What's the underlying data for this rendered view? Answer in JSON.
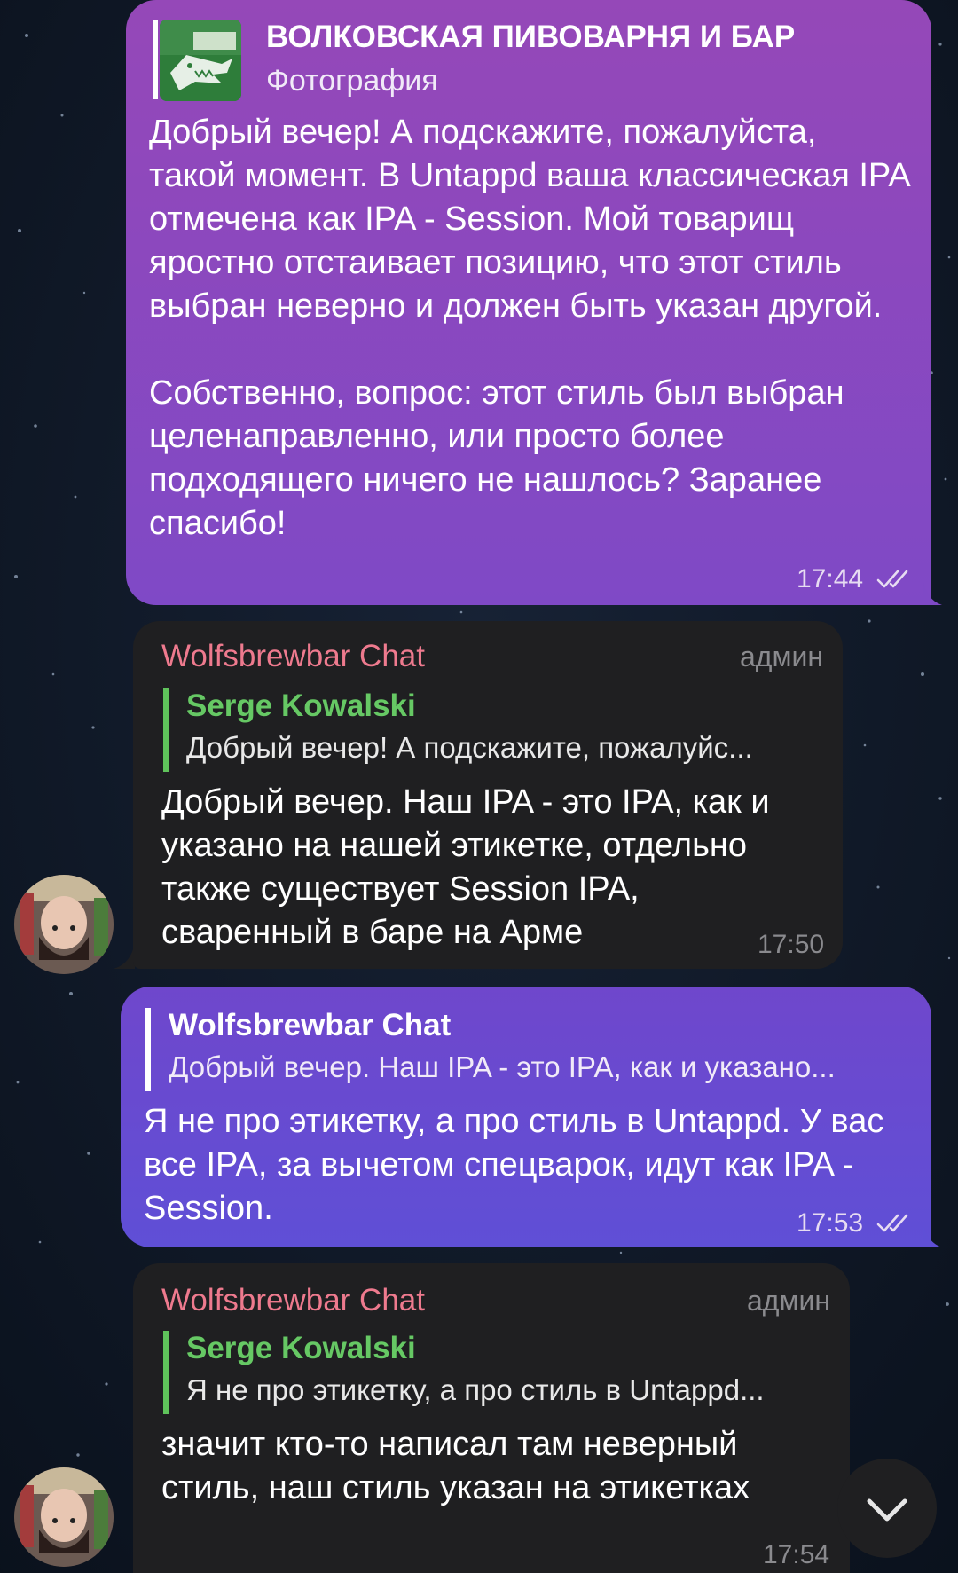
{
  "messages": [
    {
      "reply_title": "ВОЛКОВСКАЯ ПИВОВАРНЯ И БАР",
      "reply_subtitle": "Фотография",
      "text": "Добрый вечер! А подскажите, пожалуйста, такой момент. В Untappd ваша классическая IPA отмечена как IPA - Session. Мой товарищ яростно отстаивает позицию, что этот стиль выбран неверно и должен быть указан другой.\n\nСобственно, вопрос: этот стиль был выбран целенаправленно, или просто более подходящего ничего не нашлось? Заранее спасибо!",
      "time": "17:44"
    },
    {
      "sender": "Wolfsbrewbar Chat",
      "badge": "админ",
      "reply_name": "Serge Kowalski",
      "reply_text": "Добрый вечер! А подскажите, пожалуйс...",
      "text": "Добрый вечер. Наш IPA - это IPA, как и указано на нашей этикетке, отдельно также существует Session IPA, сваренный в баре на Арме",
      "time": "17:50"
    },
    {
      "reply_name": "Wolfsbrewbar Chat",
      "reply_text": "Добрый вечер. Наш IPA - это IPA, как и указано...",
      "text": "Я не про этикетку, а про стиль в Untappd. У вас все IPA, за вычетом спецварок, идут как IPA - Session.",
      "time": "17:53"
    },
    {
      "sender": "Wolfsbrewbar Chat",
      "badge": "админ",
      "reply_name": "Serge Kowalski",
      "reply_text": "Я не про этикетку, а про стиль в Untappd...",
      "text": "значит кто-то написал там неверный стиль, наш стиль указан на этикетках",
      "time": "17:54"
    }
  ],
  "icons": {
    "read_receipt": "double-check-icon",
    "scroll_down": "chevron-down-icon",
    "photo_thumbnail": "wolf-logo-thumbnail",
    "avatar": "user-avatar"
  },
  "colors": {
    "outgoing_top": "#9548b8",
    "outgoing_bottom": "#5f4fd6",
    "incoming": "#1f1f21",
    "sender_name": "#ee7a8e",
    "reply_accent": "#5fc35b",
    "background": "#0c1421"
  }
}
